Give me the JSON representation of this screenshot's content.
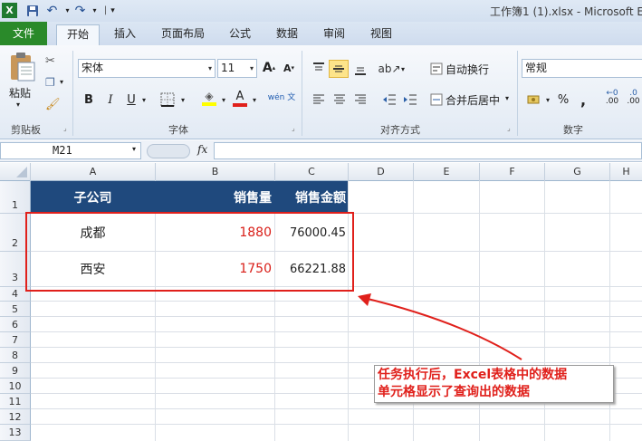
{
  "window": {
    "title": "工作簿1 (1).xlsx - Microsoft E"
  },
  "tabs": [
    "文件",
    "开始",
    "插入",
    "页面布局",
    "公式",
    "数据",
    "审阅",
    "视图"
  ],
  "clipboard": {
    "paste_label": "粘贴",
    "group_label": "剪贴板"
  },
  "font": {
    "name": "宋体",
    "size": "11",
    "group_label": "字体",
    "bold": "B",
    "italic": "I",
    "underline": "U",
    "wen_label": "wén 文"
  },
  "alignment": {
    "wrap_label": "自动换行",
    "merge_label": "合并后居中",
    "group_label": "对齐方式"
  },
  "number": {
    "format": "常规",
    "percent": "%",
    "comma": ",",
    "dec_inc": ".00",
    "dec_dec": ".00",
    "group_label": "数字"
  },
  "formula_bar": {
    "name_box": "M21",
    "fx": "fx",
    "content": ""
  },
  "columns": [
    "A",
    "B",
    "C",
    "D",
    "E",
    "F",
    "G",
    "H"
  ],
  "rows": [
    "1",
    "2",
    "3",
    "4",
    "5",
    "6",
    "7",
    "8",
    "9",
    "10",
    "11",
    "12",
    "13"
  ],
  "table": {
    "headers": [
      "子公司",
      "销售量",
      "销售金额"
    ],
    "rows": [
      [
        "成都",
        "1880",
        "76000.45"
      ],
      [
        "西安",
        "1750",
        "66221.88"
      ]
    ]
  },
  "callout": {
    "line1": "任务执行后，Excel表格中的数据",
    "line2": "单元格显示了查询出的数据"
  },
  "colors": {
    "header_bg": "#1f497d",
    "accent_red": "#e0201b",
    "sales_red": "#d91e18",
    "file_tab": "#2a8a2a"
  }
}
